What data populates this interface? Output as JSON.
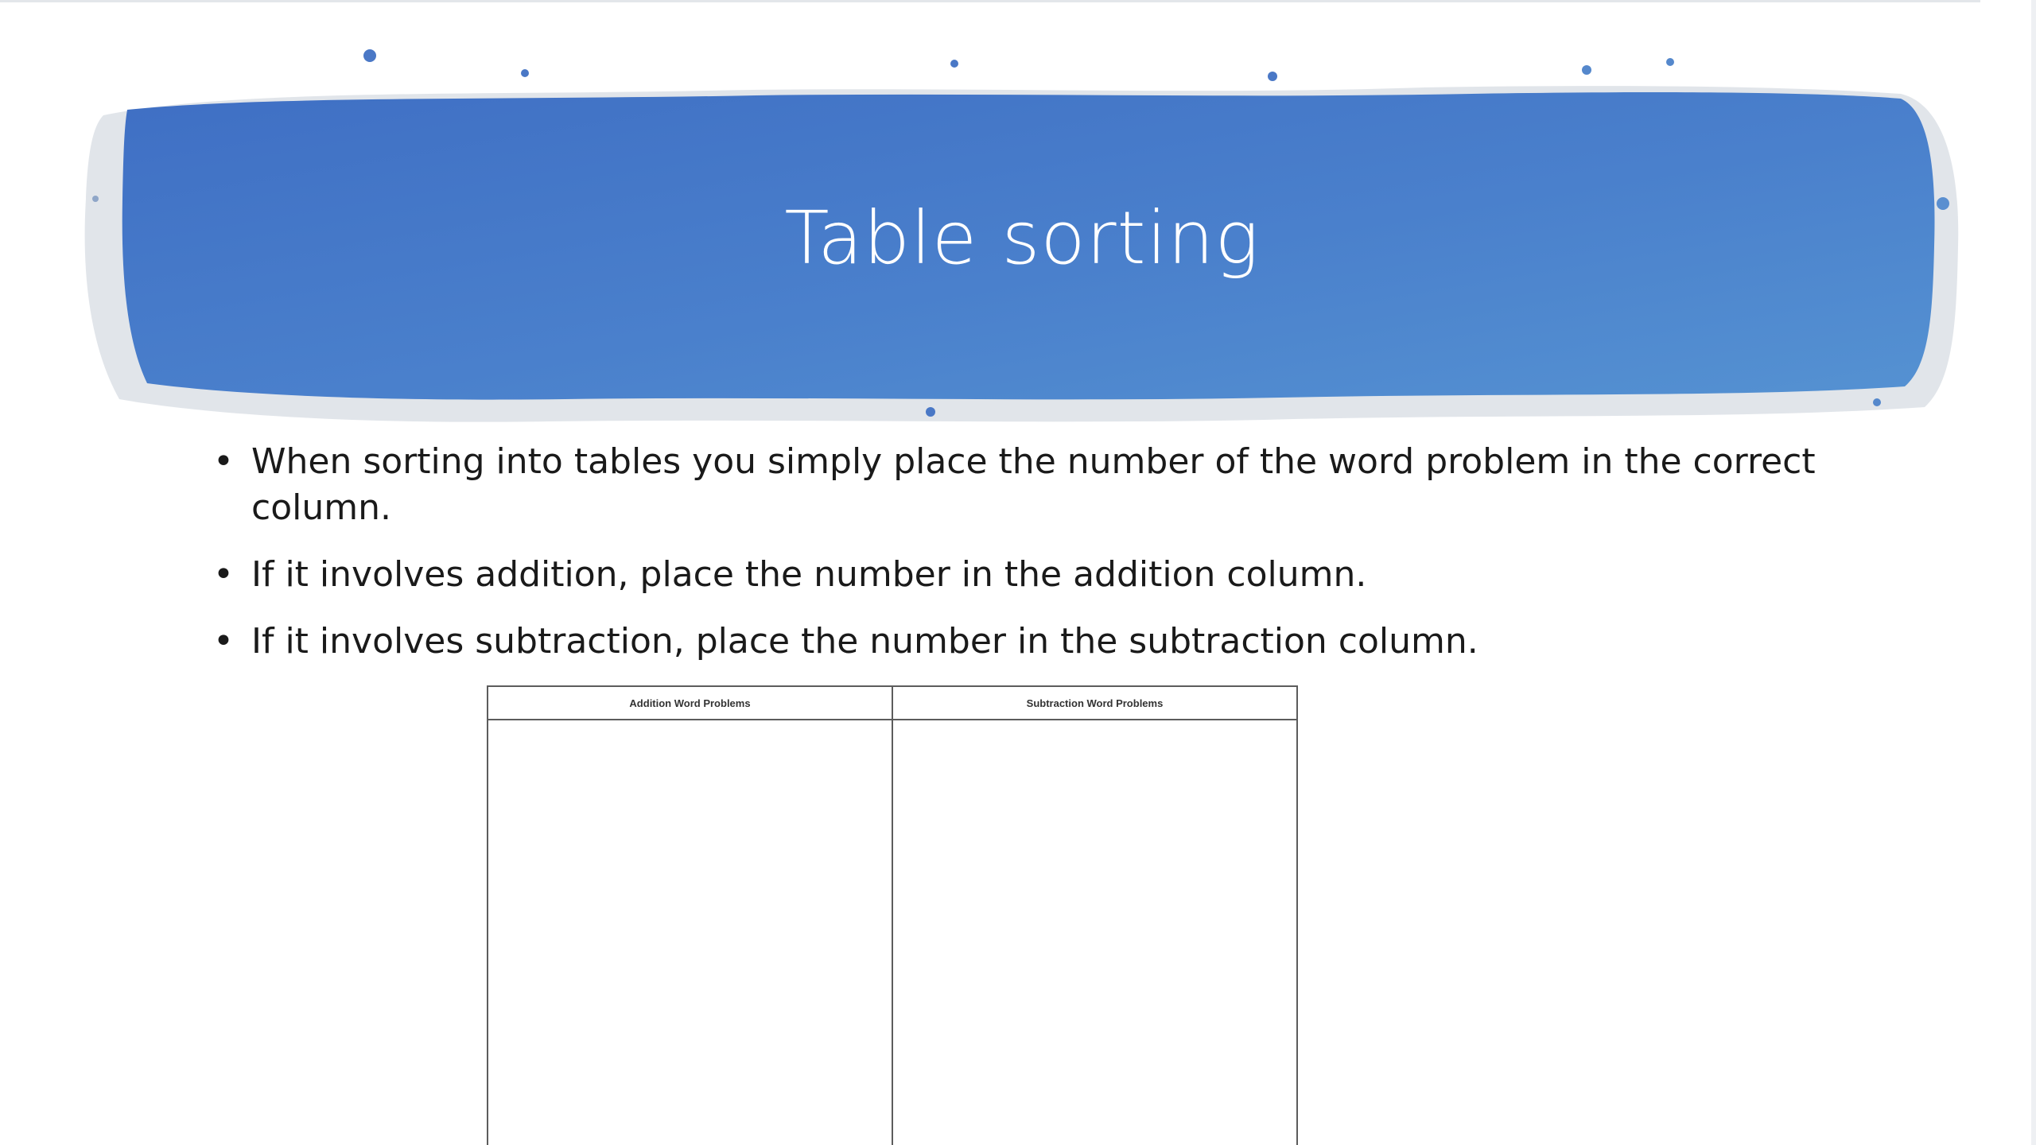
{
  "slide": {
    "title": "Table sorting",
    "banner_color": "#4a7fcb",
    "bullets": [
      "When sorting into tables you simply place the number of the word problem in the correct column.",
      "If it involves addition, place the number in the addition column.",
      "If it involves subtraction, place the number in the subtraction column."
    ],
    "bullet_glyph": "•"
  },
  "table": {
    "headers": [
      "Addition Word Problems",
      "Subtraction  Word Problems"
    ]
  }
}
